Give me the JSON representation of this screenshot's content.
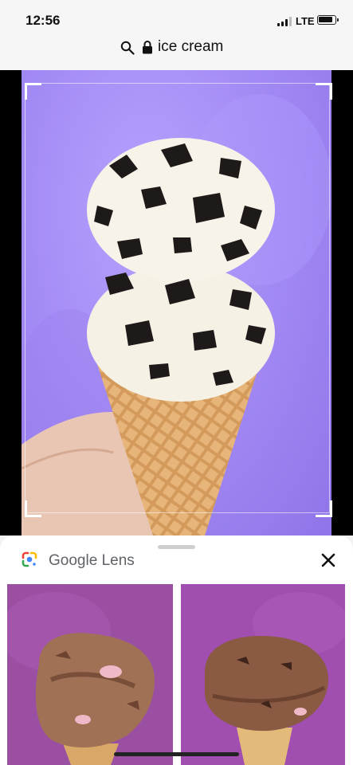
{
  "status_bar": {
    "time": "12:56",
    "network": "LTE"
  },
  "search": {
    "query": "ice cream",
    "icons": [
      "search-icon",
      "lock-icon"
    ]
  },
  "main_image": {
    "subject": "cookies-and-cream ice cream cone",
    "background_color": "#a48cf5"
  },
  "lens_panel": {
    "brand": "Google",
    "product": "Lens",
    "close_icon": "close-icon",
    "results": [
      {
        "name": "chocolate-marshmallow-ice-cream-cone",
        "bg": "#9b4fa3"
      },
      {
        "name": "chocolate-chip-ice-cream-cone",
        "bg": "#a04fb0"
      }
    ]
  },
  "colors": {
    "lens_blue": "#4285f4",
    "lens_red": "#ea4335",
    "lens_yellow": "#fbbc05",
    "lens_green": "#34a853",
    "title_gray": "#5f6368"
  }
}
